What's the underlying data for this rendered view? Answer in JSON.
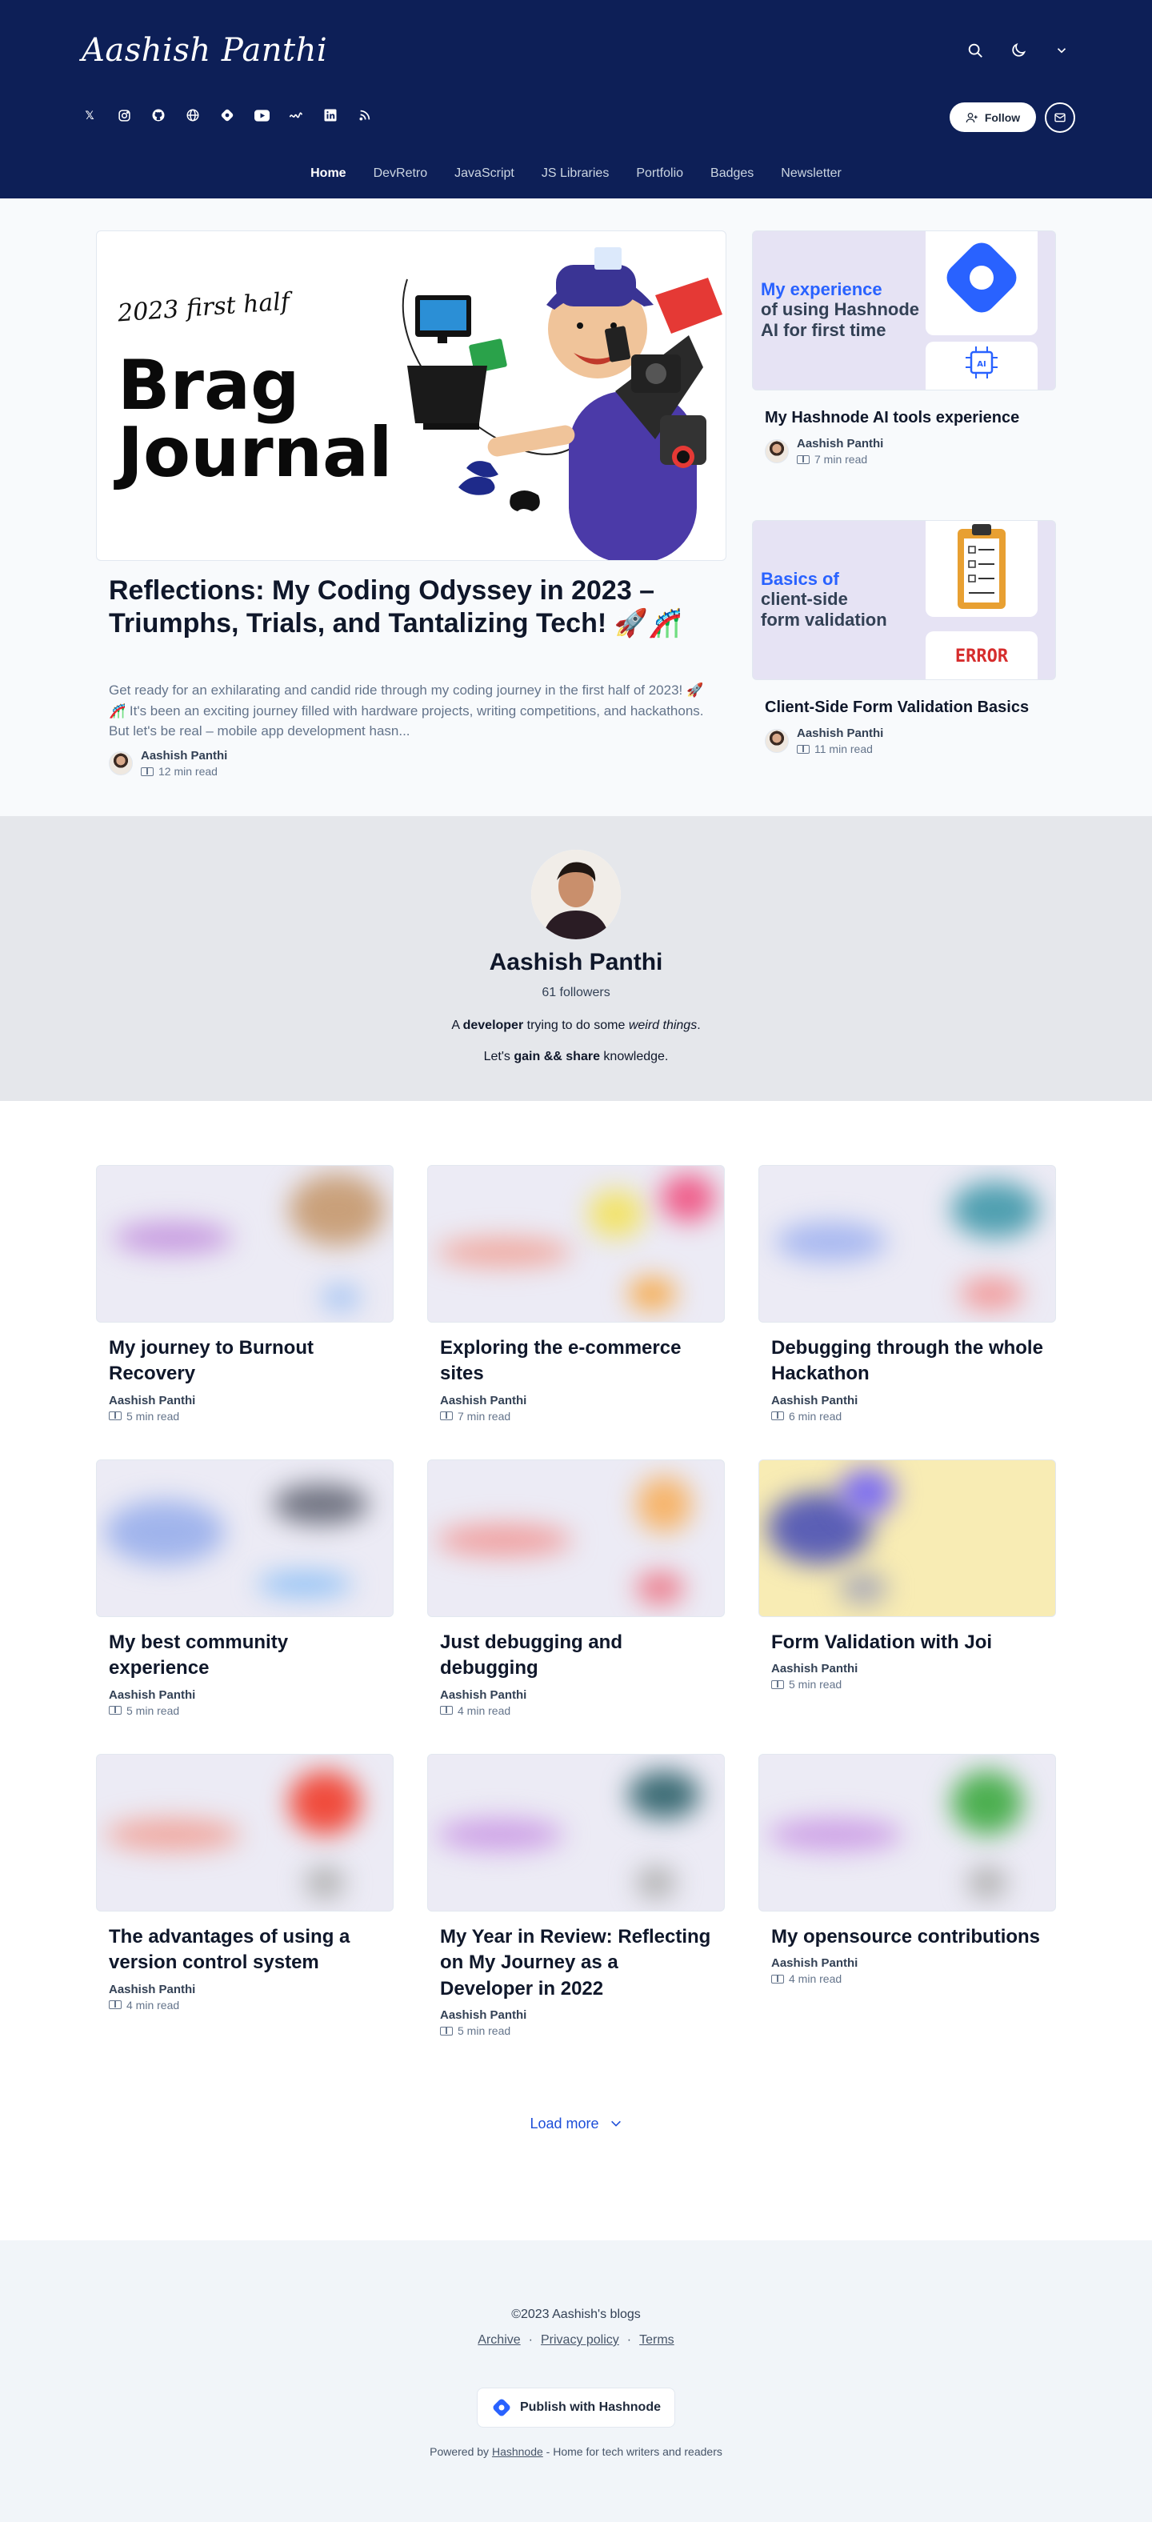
{
  "header": {
    "brand": "Aashish Panthi",
    "follow_label": "Follow",
    "social": [
      "x",
      "instagram",
      "github",
      "website",
      "hashnode",
      "youtube",
      "dev",
      "linkedin",
      "rss"
    ]
  },
  "nav": [
    "Home",
    "DevRetro",
    "JavaScript",
    "JS Libraries",
    "Portfolio",
    "Badges",
    "Newsletter"
  ],
  "featured": {
    "image_text": {
      "kicker": "2023 first half",
      "line1": "Brag",
      "line2": "Journal"
    },
    "title": "Reflections: My Coding Odyssey in 2023 – Triumphs, Trials, and Tantalizing Tech! 🚀🎢",
    "description": "Get ready for an exhilarating and candid ride through my coding journey in the first half of 2023! 🚀🎢 It's been an exciting journey filled with hardware projects, writing competitions, and hackathons. But let's be real – mobile app development hasn...",
    "author": "Aashish Panthi",
    "read": "12 min read"
  },
  "side_posts": [
    {
      "image_text": {
        "line1": "My experience",
        "line2": "of using Hashnode",
        "line3": "AI for first time"
      },
      "title": "My Hashnode AI tools experience",
      "author": "Aashish Panthi",
      "read": "7 min read"
    },
    {
      "image_text": {
        "line1": "Basics of",
        "line2": "client-side",
        "line3": "form validation",
        "badge": "ERROR"
      },
      "title": "Client-Side Form Validation Basics",
      "author": "Aashish Panthi",
      "read": "11 min read"
    }
  ],
  "profile": {
    "name": "Aashish Panthi",
    "followers": "61 followers",
    "bio_pre": "A ",
    "bio_bold": "developer",
    "bio_mid": " trying to do some ",
    "bio_italic": "weird things",
    "bio_end": ".",
    "line2_pre": "Let's ",
    "line2_bold": "gain && share",
    "line2_end": " knowledge."
  },
  "posts": [
    {
      "title": "My journey to Burnout Recovery",
      "author": "Aashish Panthi",
      "read": "5 min read"
    },
    {
      "title": "Exploring the e-commerce sites",
      "author": "Aashish Panthi",
      "read": "7 min read"
    },
    {
      "title": "Debugging through the whole Hackathon",
      "author": "Aashish Panthi",
      "read": "6 min read"
    },
    {
      "title": "My best community experience",
      "author": "Aashish Panthi",
      "read": "5 min read"
    },
    {
      "title": "Just debugging and debugging",
      "author": "Aashish Panthi",
      "read": "4 min read"
    },
    {
      "title": "Form Validation with Joi",
      "author": "Aashish Panthi",
      "read": "5 min read"
    },
    {
      "title": "The advantages of using a version control system",
      "author": "Aashish Panthi",
      "read": "4 min read"
    },
    {
      "title": "My Year in Review: Reflecting on My Journey as a Developer in 2022",
      "author": "Aashish Panthi",
      "read": "5 min read"
    },
    {
      "title": "My opensource contributions",
      "author": "Aashish Panthi",
      "read": "4 min read"
    }
  ],
  "load_more": "Load more",
  "footer": {
    "copyright": "©2023 Aashish's blogs",
    "links": [
      "Archive",
      "Privacy policy",
      "Terms"
    ],
    "publish_label": "Publish with Hashnode",
    "powered_pre": "Powered by ",
    "powered_link": "Hashnode",
    "powered_post": " - Home for tech writers and readers"
  },
  "colors": {
    "header_bg": "#0d1f57",
    "accent": "#2962ff"
  }
}
